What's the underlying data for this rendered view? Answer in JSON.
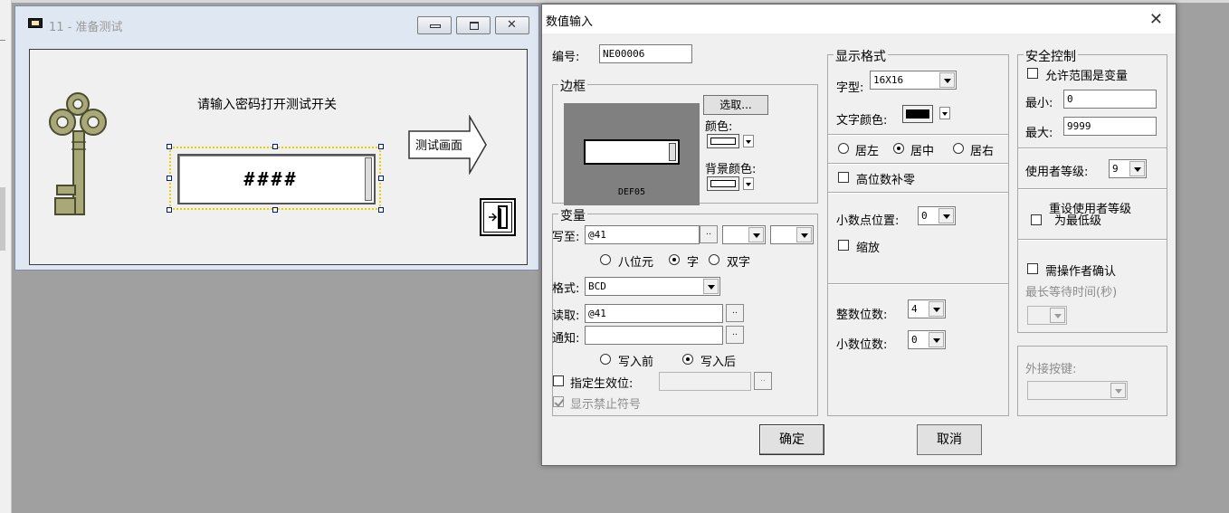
{
  "window": {
    "title": "11 - 准备测试"
  },
  "canvas": {
    "prompt": "请输入密码打开测试开关",
    "password_display": "####",
    "arrow_button_label": "测试画面"
  },
  "dialog": {
    "title": "数值输入",
    "close_glyph": "✕",
    "id_label": "编号:",
    "id_value": "NE00006",
    "frame": {
      "title": "边框",
      "select_button": "选取...",
      "color_label": "颜色:",
      "bg_color_label": "背景颜色:",
      "preview_name": "DEF05"
    },
    "variable": {
      "title": "变量",
      "write_label": "写至:",
      "write_value": "@41",
      "size_options": [
        "八位元",
        "字",
        "双字"
      ],
      "size_selected": 1,
      "format_label": "格式:",
      "format_value": "BCD",
      "read_label": "读取:",
      "read_value": "@41",
      "notify_label": "通知:",
      "notify_value": "",
      "timing_options": [
        "写入前",
        "写入后"
      ],
      "timing_selected": 1,
      "effective_bit_label": "指定生效位:",
      "show_forbidden_label": "显示禁止符号",
      "browse": ".."
    },
    "display": {
      "title": "显示格式",
      "font_label": "字型:",
      "font_value": "16X16",
      "text_color_label": "文字颜色:",
      "align_options": [
        "居左",
        "居中",
        "居右"
      ],
      "align_selected": 1,
      "zero_pad_label": "高位数补零",
      "decimal_pos_label": "小数点位置:",
      "decimal_pos_value": "0",
      "scale_label": "缩放",
      "int_digits_label": "整数位数:",
      "int_digits_value": "4",
      "dec_digits_label": "小数位数:",
      "dec_digits_value": "0"
    },
    "security": {
      "title": "安全控制",
      "range_var_label": "允许范围是变量",
      "min_label": "最小:",
      "min_value": "0",
      "max_label": "最大:",
      "max_value": "9999",
      "user_level_label": "使用者等级:",
      "user_level_value": "9",
      "reset_level_line1": "重设使用者等级",
      "reset_level_line2": "为最低级",
      "operator_confirm_label": "需操作者确认",
      "max_wait_label": "最长等待时间(秒)",
      "ext_key_label": "外接按键:"
    },
    "ok_button": "确定",
    "cancel_button": "取消"
  }
}
